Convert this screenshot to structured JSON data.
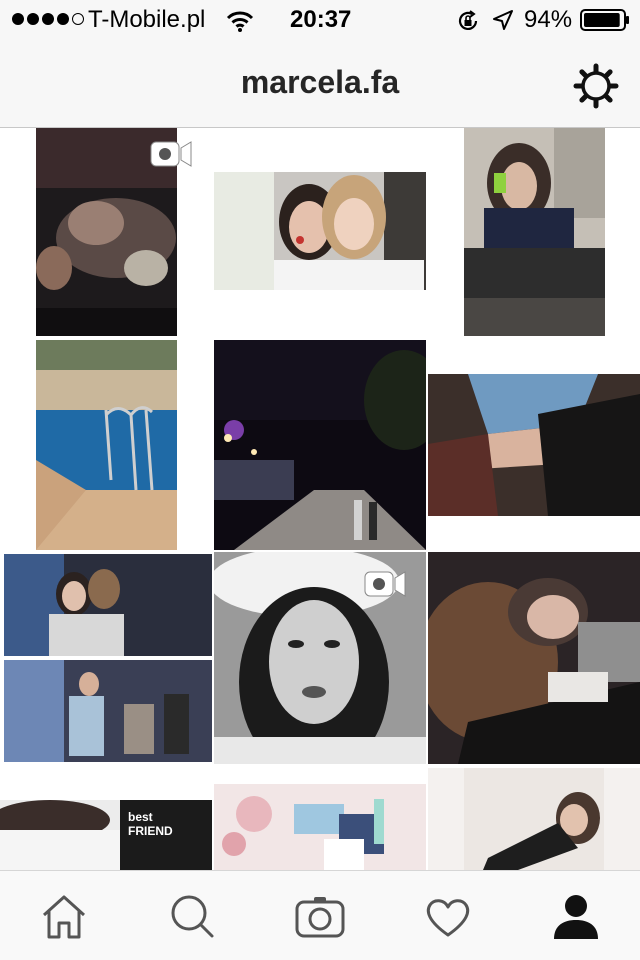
{
  "status_bar": {
    "carrier": "T-Mobile.pl",
    "time": "20:37",
    "battery": "94%",
    "battery_level": 0.94,
    "signal_bars": 4,
    "icons": [
      "wifi-icon",
      "rotation-lock-icon",
      "location-arrow-icon",
      "battery-icon"
    ]
  },
  "header": {
    "title": "marcela.fa",
    "settings_icon": "gear-icon"
  },
  "grid": {
    "posts": [
      {
        "id": "post-1",
        "kind": "video"
      },
      {
        "id": "post-2",
        "kind": "photo"
      },
      {
        "id": "post-3",
        "kind": "photo"
      },
      {
        "id": "post-4",
        "kind": "photo"
      },
      {
        "id": "post-5",
        "kind": "photo"
      },
      {
        "id": "post-6",
        "kind": "photo"
      },
      {
        "id": "post-7",
        "kind": "photo"
      },
      {
        "id": "post-8",
        "kind": "video"
      },
      {
        "id": "post-9",
        "kind": "photo"
      },
      {
        "id": "post-10",
        "kind": "photo"
      },
      {
        "id": "post-11",
        "kind": "photo"
      },
      {
        "id": "post-12",
        "kind": "photo"
      }
    ],
    "shirt_text": "best FRIEND"
  },
  "tab_bar": {
    "tabs": [
      "home-icon",
      "search-icon",
      "camera-icon",
      "heart-icon",
      "profile-icon"
    ],
    "active": "profile-icon"
  }
}
